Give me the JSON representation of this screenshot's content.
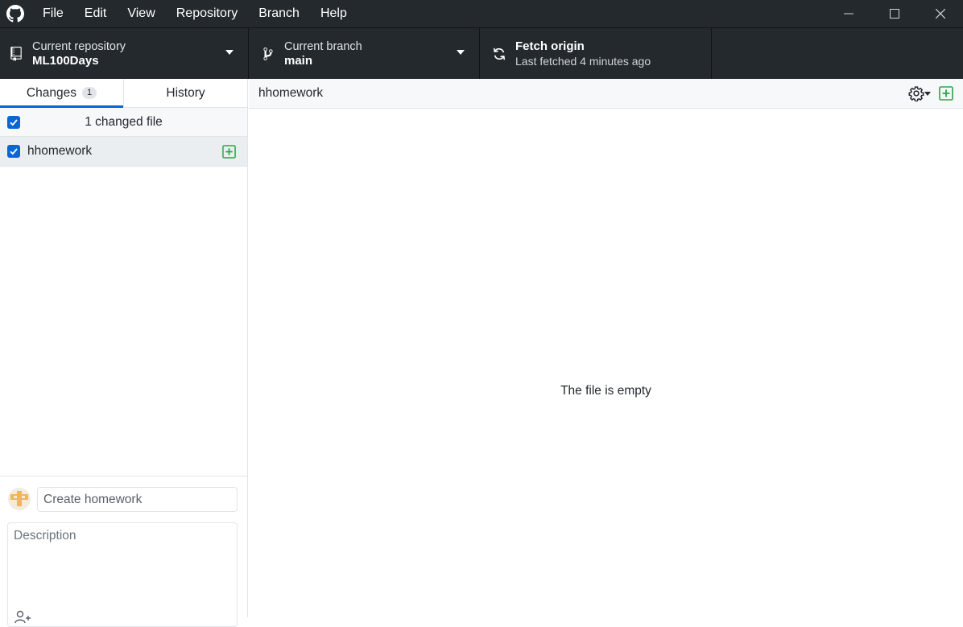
{
  "menu": [
    "File",
    "Edit",
    "View",
    "Repository",
    "Branch",
    "Help"
  ],
  "toolbar": {
    "repo_label": "Current repository",
    "repo_name": "ML100Days",
    "branch_label": "Current branch",
    "branch_name": "main",
    "fetch_title": "Fetch origin",
    "fetch_sub": "Last fetched 4 minutes ago"
  },
  "sidebar": {
    "tab_changes": "Changes",
    "changes_count": "1",
    "tab_history": "History",
    "changed_header": "1 changed file",
    "file_name": "hhomework",
    "summary_value": "Create homework",
    "description_placeholder": "Description"
  },
  "diff": {
    "path": "hhomework",
    "empty_message": "The file is empty"
  },
  "colors": {
    "chrome": "#24292e",
    "accent": "#0366d6",
    "added": "#28a745"
  },
  "icons": [
    "github-logo-icon",
    "repo-icon",
    "branch-icon",
    "sync-icon",
    "caret-down-icon",
    "gear-icon",
    "file-added-icon",
    "checkbox-checked-icon",
    "avatar",
    "add-coauthor-icon"
  ]
}
